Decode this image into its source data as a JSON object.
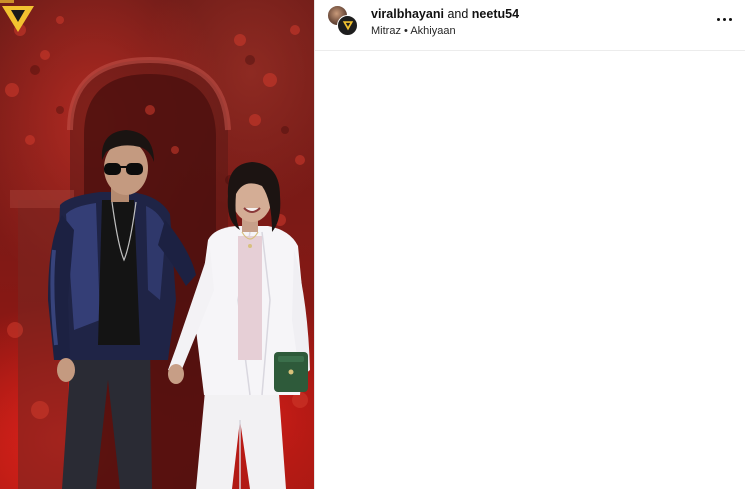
{
  "post": {
    "author_primary": "viralbhayani",
    "joiner": "and",
    "author_collab": "neetu54",
    "audio_artist": "Mitraz",
    "audio_separator": "•",
    "audio_title": "Akhiyaan",
    "more_icon": "more-horizontal-icon"
  },
  "media": {
    "type": "video",
    "watermark_icon": "viral-bhayani-v-logo"
  },
  "colors": {
    "background": "#ffffff",
    "text_primary": "#111111",
    "logo_yellow": "#f2c230",
    "backdrop_red": "#b01c16"
  }
}
